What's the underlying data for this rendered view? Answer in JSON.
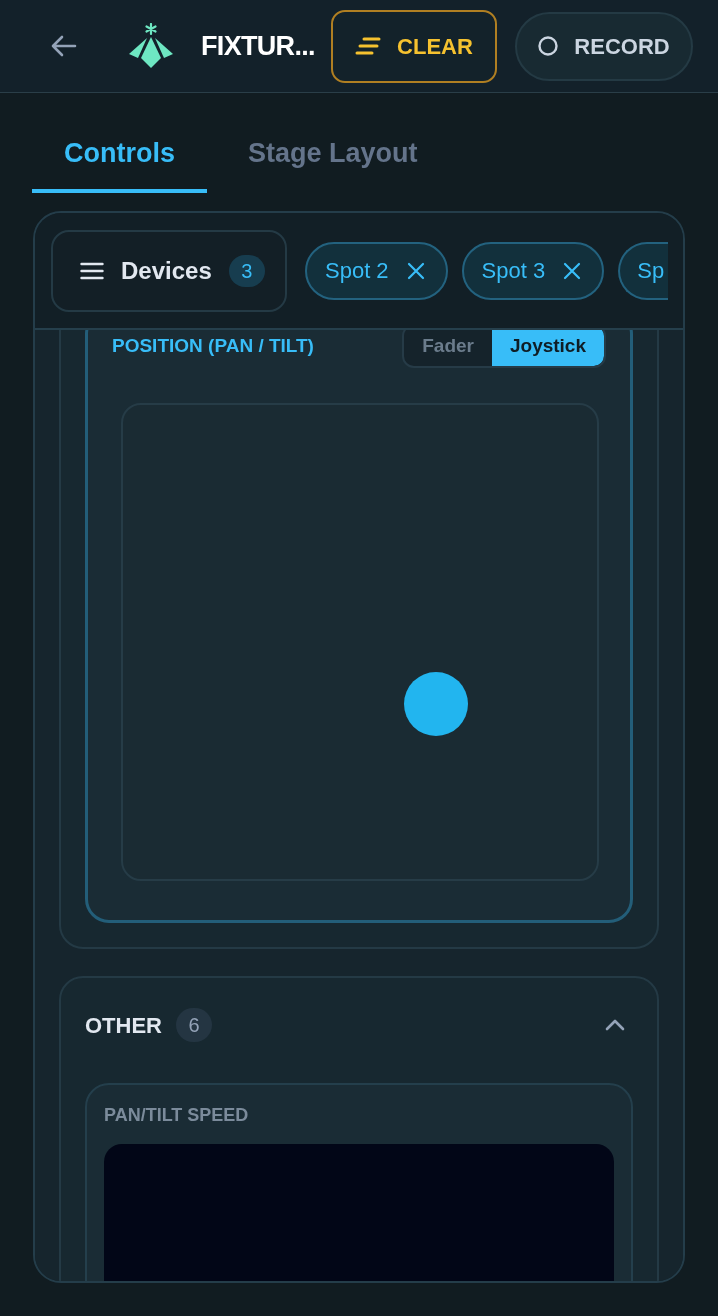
{
  "header": {
    "title": "FIXTUR...",
    "buttons": [
      {
        "kind": "clear",
        "label": "CLEAR"
      },
      {
        "kind": "record",
        "label": "RECORD"
      }
    ]
  },
  "tabs": [
    {
      "label": "Controls",
      "selected": true
    },
    {
      "label": "Stage Layout",
      "selected": false
    }
  ],
  "devices": {
    "label": "Devices",
    "count": "3"
  },
  "chips": [
    {
      "label": "Spot 2",
      "clipped": false
    },
    {
      "label": "Spot 3",
      "clipped": false
    },
    {
      "label": "Sp",
      "clipped": true
    }
  ],
  "position": {
    "title": "POSITION (PAN / TILT)",
    "modes": [
      {
        "label": "Fader",
        "selected": false
      },
      {
        "label": "Joystick",
        "selected": true
      }
    ],
    "pan": {
      "level": 0.66
    },
    "tilt": {
      "level": 0.37
    }
  },
  "section": {
    "title": "OTHER",
    "count": "6",
    "expanded": true,
    "controls": [
      {
        "label": "PAN/TILT SPEED"
      }
    ]
  }
}
